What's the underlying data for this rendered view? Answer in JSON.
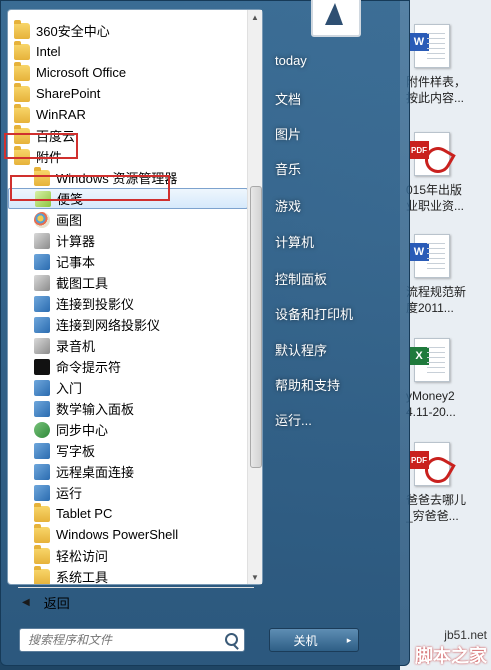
{
  "start_menu": {
    "programs": [
      {
        "label": "360安全中心",
        "type": "folder",
        "level": 0
      },
      {
        "label": "Intel",
        "type": "folder",
        "level": 0
      },
      {
        "label": "Microsoft Office",
        "type": "folder",
        "level": 0
      },
      {
        "label": "SharePoint",
        "type": "folder",
        "level": 0
      },
      {
        "label": "WinRAR",
        "type": "folder",
        "level": 0
      },
      {
        "label": "百度云",
        "type": "folder",
        "level": 0
      },
      {
        "label": "附件",
        "type": "folder",
        "level": 0,
        "open": true
      },
      {
        "label": "Windows 资源管理器",
        "type": "folder",
        "level": 1
      },
      {
        "label": "便笺",
        "type": "app",
        "level": 1,
        "selected": true
      },
      {
        "label": "画图",
        "type": "app",
        "level": 1
      },
      {
        "label": "计算器",
        "type": "app",
        "level": 1
      },
      {
        "label": "记事本",
        "type": "app",
        "level": 1
      },
      {
        "label": "截图工具",
        "type": "app",
        "level": 1
      },
      {
        "label": "连接到投影仪",
        "type": "app",
        "level": 1
      },
      {
        "label": "连接到网络投影仪",
        "type": "app",
        "level": 1
      },
      {
        "label": "录音机",
        "type": "app",
        "level": 1
      },
      {
        "label": "命令提示符",
        "type": "app",
        "level": 1
      },
      {
        "label": "入门",
        "type": "app",
        "level": 1
      },
      {
        "label": "数学输入面板",
        "type": "app",
        "level": 1
      },
      {
        "label": "同步中心",
        "type": "app",
        "level": 1
      },
      {
        "label": "写字板",
        "type": "app",
        "level": 1
      },
      {
        "label": "远程桌面连接",
        "type": "app",
        "level": 1
      },
      {
        "label": "运行",
        "type": "app",
        "level": 1
      },
      {
        "label": "Tablet PC",
        "type": "folder",
        "level": 1
      },
      {
        "label": "Windows PowerShell",
        "type": "folder",
        "level": 1
      },
      {
        "label": "轻松访问",
        "type": "folder",
        "level": 1
      },
      {
        "label": "系统工具",
        "type": "folder",
        "level": 1
      }
    ],
    "back_label": "返回",
    "search_placeholder": "搜索程序和文件",
    "right_links": [
      "today",
      "文档",
      "图片",
      "音乐",
      "游戏",
      "计算机",
      "控制面板",
      "设备和打印机",
      "默认程序",
      "帮助和支持",
      "运行..."
    ],
    "shutdown_label": "关机",
    "shutdown_arrow": "▸"
  },
  "desktop": {
    "icons": [
      {
        "type": "word",
        "badge": "W",
        "lines": [
          "附件样表，",
          "按此内容..."
        ]
      },
      {
        "type": "pdf",
        "badge": "PDF",
        "lines": [
          "015年出版",
          "业职业资..."
        ]
      },
      {
        "type": "word",
        "badge": "W",
        "lines": [
          "流程规范新",
          "度2011..."
        ]
      },
      {
        "type": "excel",
        "badge": "X",
        "lines": [
          "yMoney2",
          "4.11-20..."
        ]
      },
      {
        "type": "pdf",
        "badge": "PDF",
        "lines": [
          "爸爸去哪儿",
          "_穷爸爸..."
        ]
      }
    ]
  },
  "watermark": {
    "site": "jb51.net",
    "name": "脚本之家"
  },
  "colors": {
    "highlight": "#d0302e",
    "selection": "#d6e9fb"
  }
}
